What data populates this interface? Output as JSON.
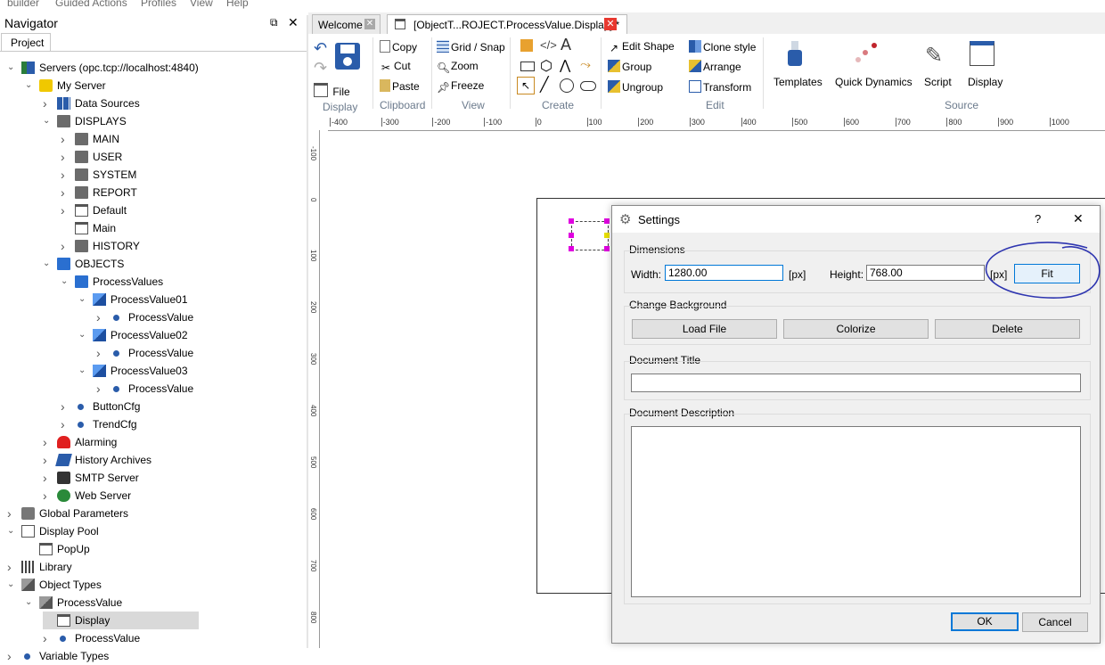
{
  "menubar": [
    "builder",
    "Guided Actions",
    "Profiles",
    "View",
    "Help"
  ],
  "navigator": {
    "title": "Navigator",
    "tab": "Project",
    "tree": [
      {
        "label": "Servers (opc.tcp://localhost:4840)",
        "icon": "servers-icon",
        "expand": "open"
      },
      {
        "label": "My Server",
        "icon": "server-icon",
        "expand": "open"
      },
      {
        "label": "Data Sources",
        "icon": "datasources-icon",
        "expand": "closed"
      },
      {
        "label": "DISPLAYS",
        "icon": "folder-icon",
        "expand": "open"
      },
      {
        "label": "MAIN",
        "icon": "folder-icon",
        "expand": "closed"
      },
      {
        "label": "USER",
        "icon": "folder-icon",
        "expand": "closed"
      },
      {
        "label": "SYSTEM",
        "icon": "folder-icon",
        "expand": "closed"
      },
      {
        "label": "REPORT",
        "icon": "folder-icon",
        "expand": "closed"
      },
      {
        "label": "Default",
        "icon": "display-icon",
        "expand": "closed"
      },
      {
        "label": "Main",
        "icon": "display-icon",
        "expand": "none"
      },
      {
        "label": "HISTORY",
        "icon": "folder-icon",
        "expand": "closed"
      },
      {
        "label": "OBJECTS",
        "icon": "folder-blue-icon",
        "expand": "open"
      },
      {
        "label": "ProcessValues",
        "icon": "folder-blue-icon",
        "expand": "open"
      },
      {
        "label": "ProcessValue01",
        "icon": "cube-icon",
        "expand": "open"
      },
      {
        "label": "ProcessValue",
        "icon": "dot-icon",
        "expand": "closed"
      },
      {
        "label": "ProcessValue02",
        "icon": "cube-icon",
        "expand": "open"
      },
      {
        "label": "ProcessValue",
        "icon": "dot-icon",
        "expand": "closed"
      },
      {
        "label": "ProcessValue03",
        "icon": "cube-icon",
        "expand": "open"
      },
      {
        "label": "ProcessValue",
        "icon": "dot-icon",
        "expand": "closed"
      },
      {
        "label": "ButtonCfg",
        "icon": "dot-icon",
        "expand": "closed"
      },
      {
        "label": "TrendCfg",
        "icon": "dot-icon",
        "expand": "closed"
      },
      {
        "label": "Alarming",
        "icon": "alarm-icon",
        "expand": "closed"
      },
      {
        "label": "History Archives",
        "icon": "archive-icon",
        "expand": "closed"
      },
      {
        "label": "SMTP Server",
        "icon": "smtp-icon",
        "expand": "closed"
      },
      {
        "label": "Web Server",
        "icon": "webserver-icon",
        "expand": "closed"
      },
      {
        "label": "Global Parameters",
        "icon": "camera-icon",
        "expand": "closed"
      },
      {
        "label": "Display Pool",
        "icon": "displaypool-icon",
        "expand": "open"
      },
      {
        "label": "PopUp",
        "icon": "display-icon",
        "expand": "none"
      },
      {
        "label": "Library",
        "icon": "library-icon",
        "expand": "closed"
      },
      {
        "label": "Object Types",
        "icon": "cube-gray-icon",
        "expand": "open"
      },
      {
        "label": "ProcessValue",
        "icon": "cube-gray-icon",
        "expand": "open"
      },
      {
        "label": "Display",
        "icon": "display-icon",
        "expand": "none",
        "selected": true
      },
      {
        "label": "ProcessValue",
        "icon": "dot-icon",
        "expand": "closed"
      },
      {
        "label": "Variable Types",
        "icon": "dot-icon",
        "expand": "closed"
      }
    ]
  },
  "tabs": [
    {
      "label": "Welcome"
    },
    {
      "label": "[ObjectT...ROJECT.ProcessValue.Display] *"
    }
  ],
  "ribbon": {
    "display": {
      "file": "File",
      "group": "Display"
    },
    "clipboard": {
      "copy": "Copy",
      "cut": "Cut",
      "paste": "Paste",
      "group": "Clipboard"
    },
    "view": {
      "grid": "Grid / Snap",
      "zoom": "Zoom",
      "freeze": "Freeze",
      "group": "View"
    },
    "create": {
      "group": "Create"
    },
    "edit": {
      "edit_shape": "Edit Shape",
      "group_btn": "Group",
      "ungroup": "Ungroup",
      "clone_style": "Clone style",
      "arrange": "Arrange",
      "transform": "Transform",
      "group": "Edit"
    },
    "source": {
      "templates": "Templates",
      "quick_dynamics": "Quick Dynamics",
      "script": "Script",
      "display": "Display",
      "group": "Source"
    }
  },
  "ruler": {
    "top": [
      "-400",
      "-300",
      "-200",
      "-100",
      "0",
      "100",
      "200",
      "300",
      "400",
      "500",
      "600",
      "700",
      "800",
      "900",
      "1000"
    ],
    "left": [
      "-100",
      "0",
      "100",
      "200",
      "300",
      "400",
      "500",
      "600",
      "700",
      "800"
    ]
  },
  "dialog": {
    "title": "Settings",
    "help": "?",
    "close": "✕",
    "dimensions_label": "Dimensions",
    "width_label": "Width:",
    "width_value": "1280.00",
    "height_label": "Height:",
    "height_value": "768.00",
    "unit": "[px]",
    "fit": "Fit",
    "background_label": "Change Background",
    "load_file": "Load File",
    "colorize": "Colorize",
    "delete": "Delete",
    "doc_title_label": "Document Title",
    "doc_title_value": "",
    "doc_desc_label": "Document Description",
    "doc_desc_value": "",
    "ok": "OK",
    "cancel": "Cancel"
  },
  "colors": {
    "annotation": "#2e35b0",
    "ok_border": "#0078d7",
    "fit_bg": "#e5f1fb"
  }
}
